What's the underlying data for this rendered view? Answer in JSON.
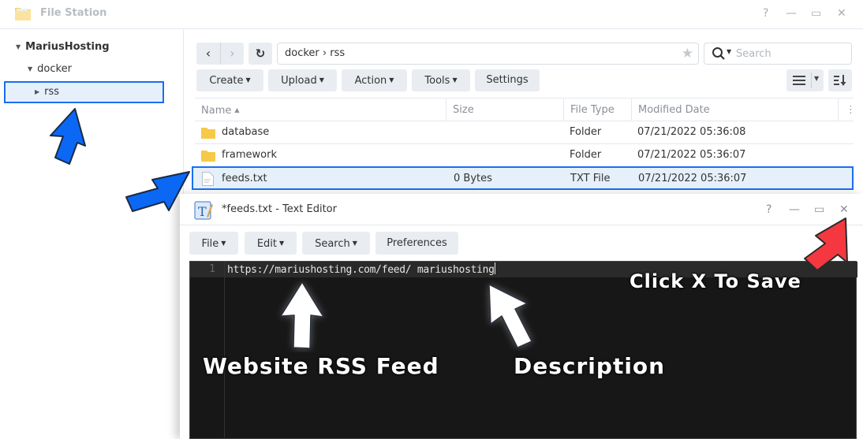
{
  "file_station": {
    "title": "File Station",
    "window_controls": {
      "help": "?",
      "minimize": "—",
      "maximize": "▭",
      "close": "✕"
    },
    "tree": [
      {
        "label": "MariusHosting",
        "expanded": true,
        "level": 0
      },
      {
        "label": "docker",
        "expanded": true,
        "level": 1
      },
      {
        "label": "rss",
        "expanded": false,
        "level": 2,
        "selected": true
      }
    ],
    "nav": {
      "back": "‹",
      "forward": "›",
      "refresh": "↻"
    },
    "path": {
      "segments": [
        "docker",
        "rss"
      ],
      "text": "docker › rss"
    },
    "search": {
      "placeholder": "Search"
    },
    "toolbar": {
      "create": "Create",
      "upload": "Upload",
      "action": "Action",
      "tools": "Tools",
      "settings": "Settings"
    },
    "columns": {
      "name": "Name",
      "size": "Size",
      "type": "File Type",
      "modified": "Modified Date"
    },
    "files": [
      {
        "name": "database",
        "size": "",
        "type": "Folder",
        "modified": "07/21/2022 05:36:08",
        "icon": "folder-icon"
      },
      {
        "name": "framework",
        "size": "",
        "type": "Folder",
        "modified": "07/21/2022 05:36:07",
        "icon": "folder-icon"
      },
      {
        "name": "feeds.txt",
        "size": "0 Bytes",
        "type": "TXT File",
        "modified": "07/21/2022 05:36:07",
        "icon": "text-file-icon",
        "selected": true
      }
    ]
  },
  "text_editor": {
    "title": "*feeds.txt - Text Editor",
    "window_controls": {
      "help": "?",
      "minimize": "—",
      "maximize": "▭",
      "close": "✕"
    },
    "menu": {
      "file": "File",
      "edit": "Edit",
      "search": "Search",
      "preferences": "Preferences"
    },
    "lines": [
      {
        "number": "1",
        "text": "https://mariushosting.com/feed/ mariushosting"
      }
    ]
  },
  "annotations": {
    "click_x": "Click X To Save",
    "rss_feed": "Website RSS Feed",
    "description": "Description"
  },
  "colors": {
    "selection_border": "#1a6ef0",
    "selection_bg": "#e6f0fb",
    "arrow_blue": "#0a68f5",
    "arrow_red": "#f5383f",
    "editor_bg": "#171717"
  }
}
